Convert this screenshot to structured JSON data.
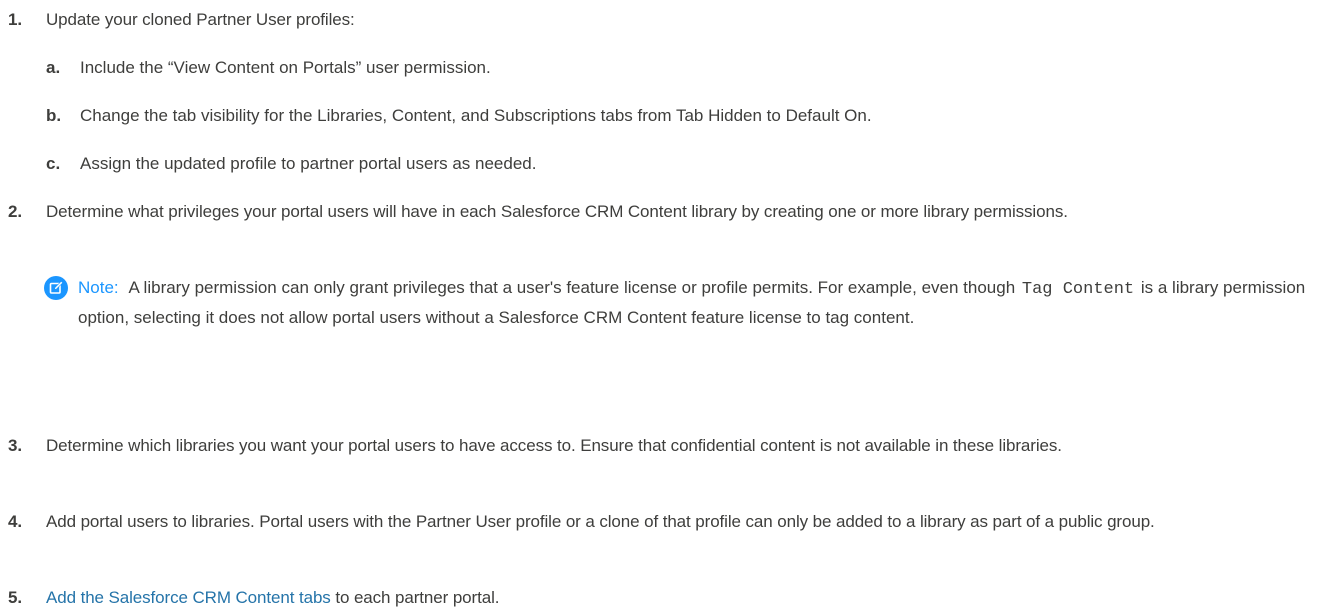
{
  "steps": [
    {
      "number": "1.",
      "text": "Update your cloned Partner User profiles:",
      "substeps": [
        {
          "letter": "a.",
          "text": "Include the “View Content on Portals” user permission."
        },
        {
          "letter": "b.",
          "text": "Change the tab visibility for the Libraries, Content, and Subscriptions tabs from Tab Hidden to Default On."
        },
        {
          "letter": "c.",
          "text": "Assign the updated profile to partner portal users as needed."
        }
      ]
    },
    {
      "number": "2.",
      "text": "Determine what privileges your portal users will have in each Salesforce CRM Content library by creating one or more library permissions.",
      "note": {
        "icon": "edit-note-icon",
        "label": "Note:",
        "text_before": "A library permission can only grant privileges that a user's feature license or profile permits. For example, even though",
        "code": "Tag Content",
        "text_after": "is a library permission option, selecting it does not allow portal users without a Salesforce CRM Content feature license to tag content."
      }
    },
    {
      "number": "3.",
      "text": "Determine which libraries you want your portal users to have access to. Ensure that confidential content is not available in these libraries."
    },
    {
      "number": "4.",
      "text": "Add portal users to libraries. Portal users with the Partner User profile or a clone of that profile can only be added to a library as part of a public group."
    },
    {
      "number": "5.",
      "link": "Add the Salesforce CRM Content tabs",
      "text": " to each partner portal."
    }
  ],
  "colors": {
    "text": "#3e3e3c",
    "note_label": "#1b96ff",
    "link": "#2574a9"
  }
}
